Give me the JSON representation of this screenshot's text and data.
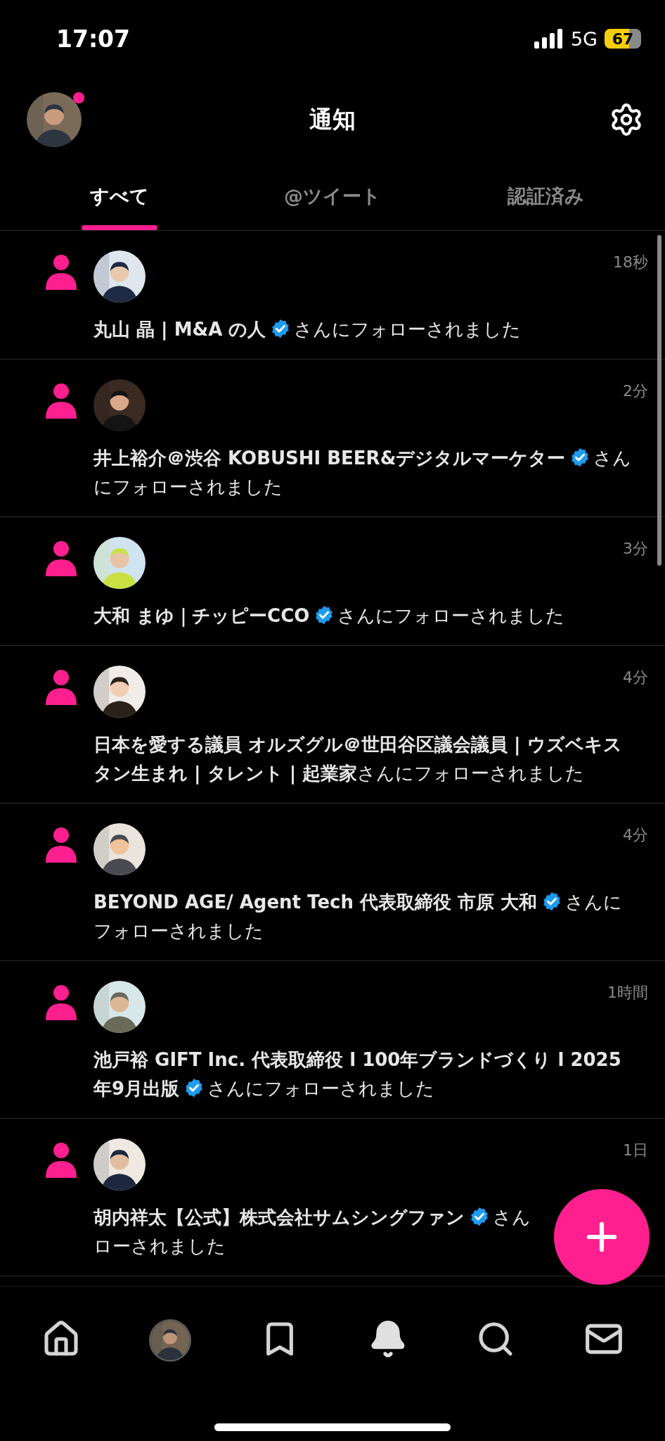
{
  "status_bar": {
    "time": "17:07",
    "network": "5G",
    "battery": "67"
  },
  "header": {
    "title": "通知",
    "has_unread_dot": true
  },
  "tabs": [
    {
      "label": "すべて",
      "selected": true
    },
    {
      "label": "@ツイート",
      "selected": false
    },
    {
      "label": "認証済み",
      "selected": false
    }
  ],
  "notifications": [
    {
      "name": "丸山 晶 | M&A の人",
      "verified": true,
      "suffix": "さんにフォローされました",
      "time": "18秒"
    },
    {
      "name": "井上裕介＠渋谷 KOBUSHI BEER&デジタルマーケター",
      "verified": true,
      "suffix": "さんにフォローされました",
      "time": "2分"
    },
    {
      "name": "大和 まゆ｜チッピーCCO",
      "verified": true,
      "suffix": "さんにフォローされました",
      "time": "3分"
    },
    {
      "name": "日本を愛する議員 オルズグル＠世田谷区議会議員 | ウズベキスタン生まれ | タレント | 起業家",
      "verified": false,
      "suffix": "さんにフォローされました",
      "time": "4分"
    },
    {
      "name": "BEYOND AGE/ Agent Tech 代表取締役 市原 大和",
      "verified": true,
      "suffix": "さんにフォローされました",
      "time": "4分"
    },
    {
      "name": "池戸裕 GIFT Inc. 代表取締役 l 100年ブランドづくり l 2025年9月出版",
      "verified": true,
      "suffix": "さんにフォローされました",
      "time": "1時間"
    },
    {
      "name": "胡内祥太【公式】株式会社サムシングファン",
      "verified": true,
      "suffix": "さん",
      "continued": "ローされました",
      "time": "1日"
    }
  ],
  "nav": [
    {
      "kind": "home",
      "selected": false
    },
    {
      "kind": "profile",
      "selected": false
    },
    {
      "kind": "bookmark",
      "selected": false
    },
    {
      "kind": "bell",
      "selected": true
    },
    {
      "kind": "search",
      "selected": false
    },
    {
      "kind": "mail",
      "selected": false
    }
  ]
}
